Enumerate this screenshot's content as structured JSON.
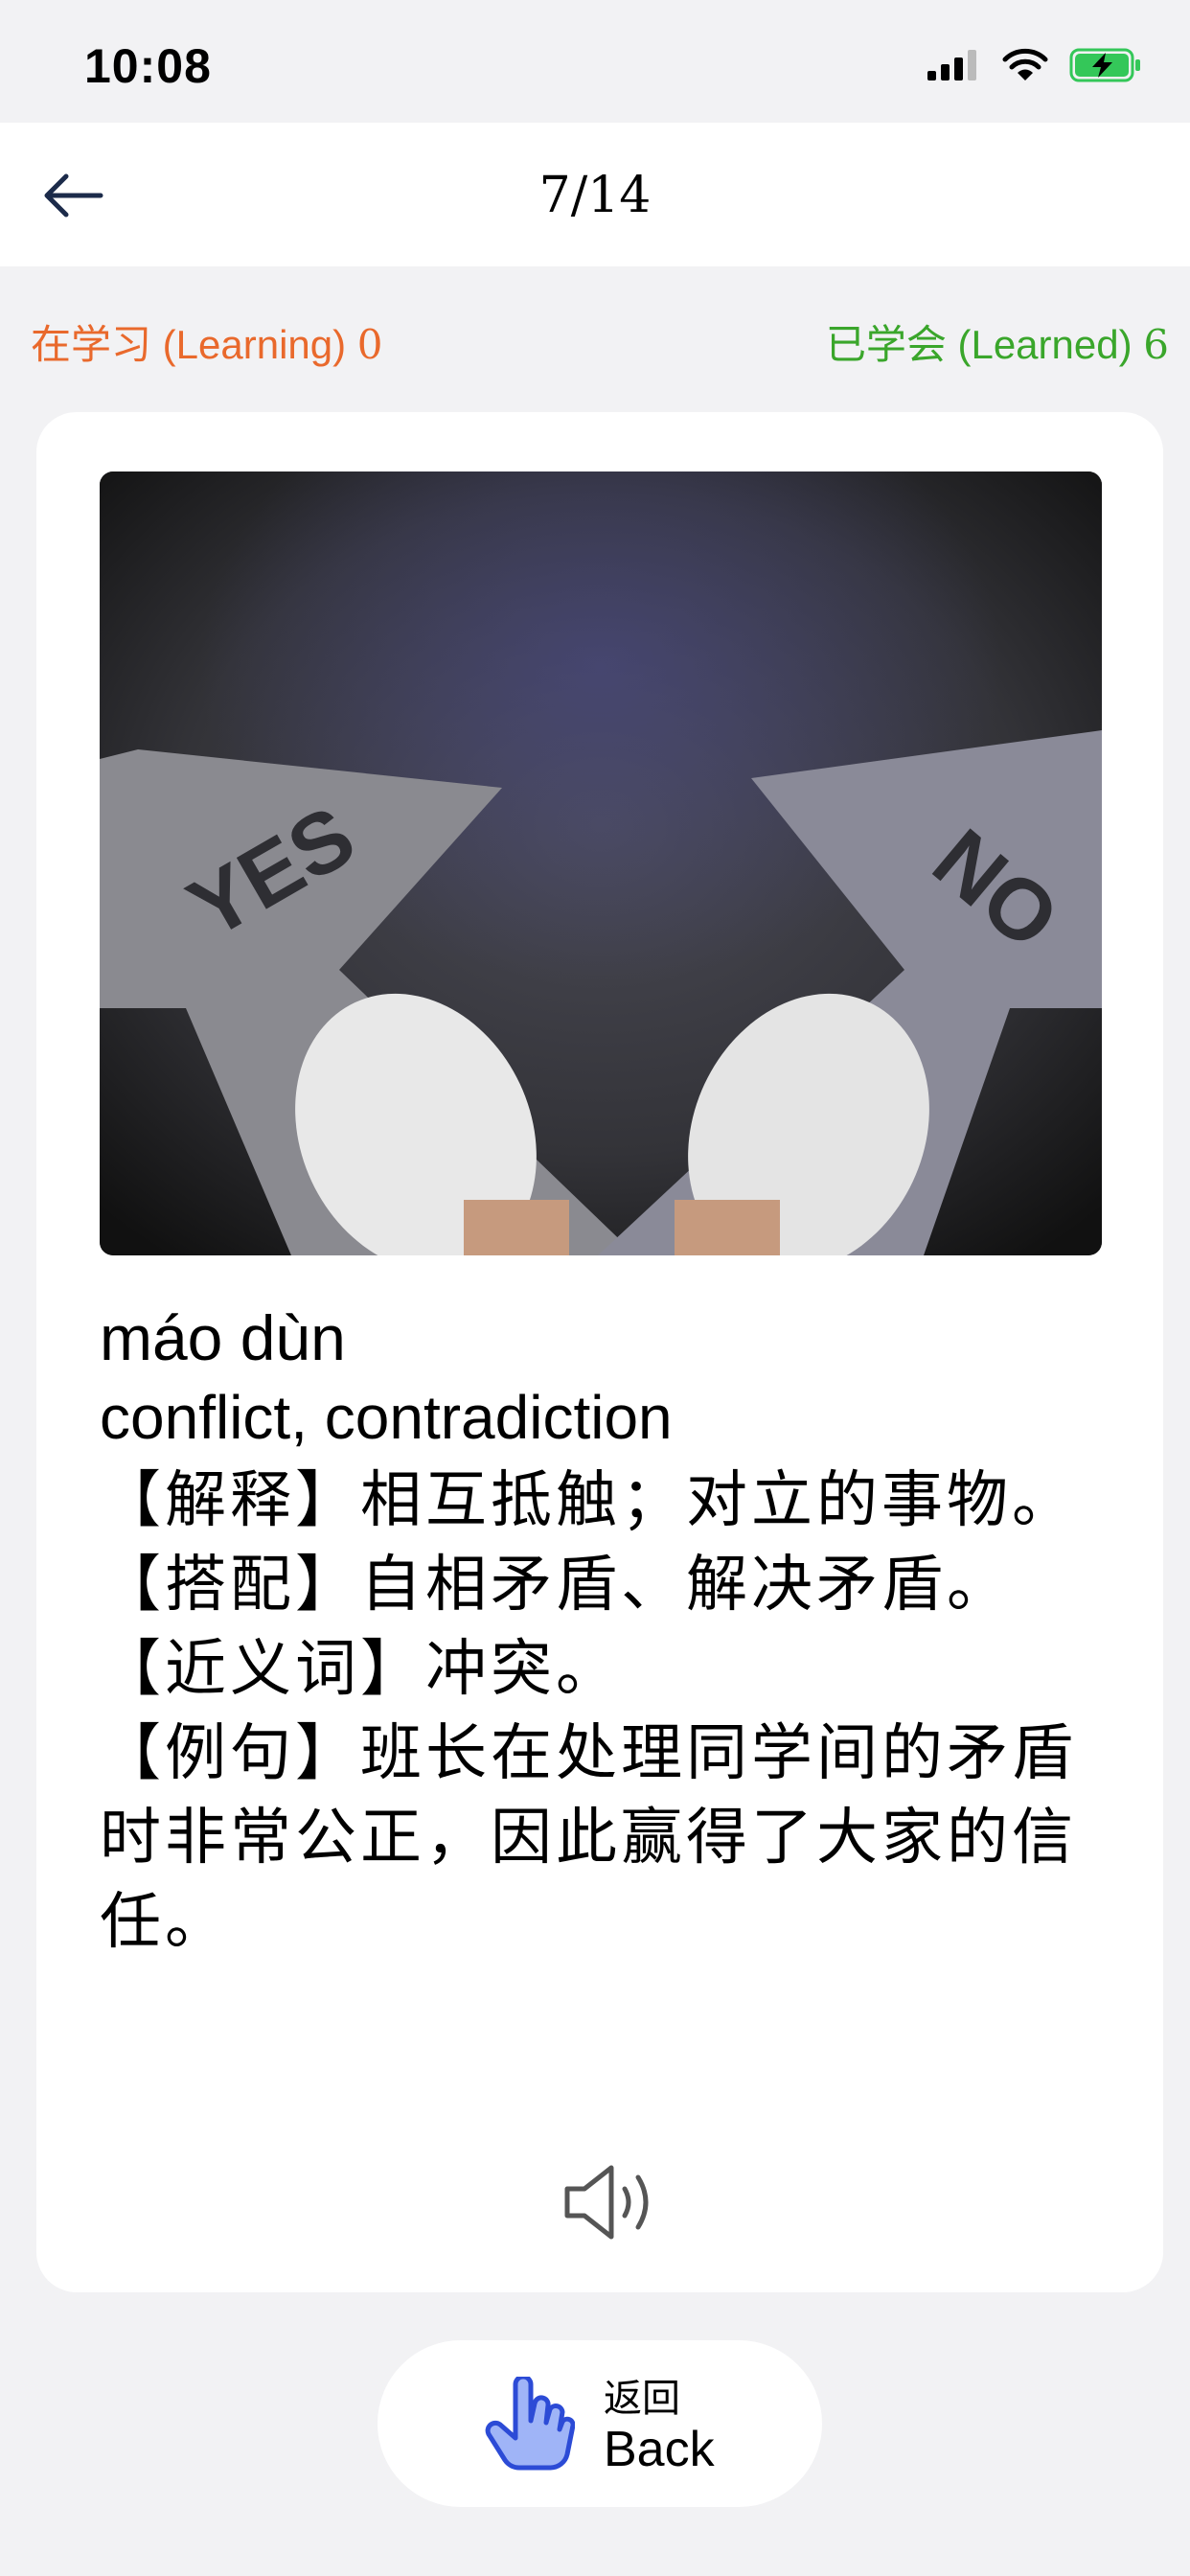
{
  "status": {
    "time": "10:08"
  },
  "header": {
    "progress": "7/14"
  },
  "counts": {
    "learning_label": "在学习 (Learning)",
    "learning_value": "0",
    "learned_label": "已学会 (Learned)",
    "learned_value": "6"
  },
  "card": {
    "image": {
      "sign_left": "YES",
      "sign_right": "NO"
    },
    "pinyin": "máo dùn",
    "english": "conflict, contradiction",
    "definitions": [
      "【解释】相互抵触；对立的事物。",
      "【搭配】自相矛盾、解决矛盾。",
      "【近义词】冲突。",
      "【例句】班长在处理同学间的矛盾时非常公正，因此赢得了大家的信任。"
    ]
  },
  "back_button": {
    "label_cn": "返回",
    "label_en": "Back"
  },
  "icons": {
    "back": "arrow-left-icon",
    "speaker": "speaker-icon",
    "hand": "hand-pointer-icon",
    "signal": "signal-icon",
    "wifi": "wifi-icon",
    "battery": "battery-charging-icon"
  },
  "colors": {
    "learning": "#e9692c",
    "learned": "#3aa62b",
    "background": "#f2f2f4",
    "icon_blue": "#3b5bdb"
  }
}
